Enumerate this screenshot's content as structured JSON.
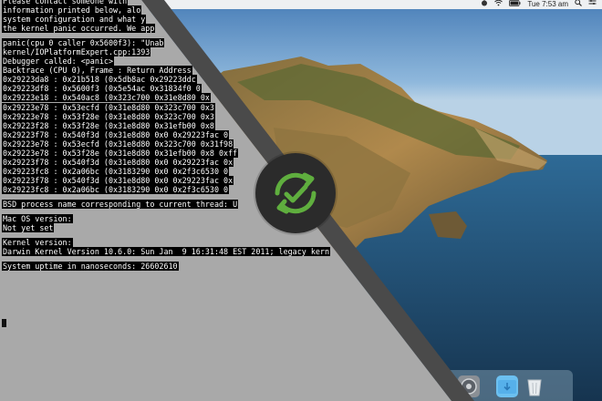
{
  "menubar": {
    "time": "Tue 7:53 am",
    "icons": [
      "apple-icon",
      "wifi-icon",
      "battery-icon",
      "clock-time",
      "search-icon",
      "control-center-icon"
    ]
  },
  "panic": {
    "lines": [
      "Please contact someone with",
      "information printed below, alo",
      "system configuration and what y",
      "the kernel panic occurred. We app",
      "",
      "panic(cpu 0 caller 0x5600f3): \"Unab",
      "kernel/IOPlatformExpert.cpp:1393",
      "Debugger called: <panic>",
      "Backtrace (CPU 0), Frame : Return Address",
      "0x29223da8 : 0x21b518 (0x5db8ac 0x29223ddc",
      "0x29223df8 : 0x5600f3 (0x5e54ac 0x31834f0 0",
      "0x29223e18 : 0x540ac8 (0x323c700 0x31e8d80 0x",
      "0x29223e78 : 0x53ecfd (0x31e8d80 0x323c700 0x3",
      "0x29223e78 : 0x53f28e (0x31e8d80 0x323c700 0x3",
      "0x29223f28 : 0x53f28e (0x31e8d80 0x31efb00 0x8",
      "0x29223f78 : 0x540f3d (0x31e8d80 0x0 0x29223fac 0",
      "0x29223e78 : 0x53ecfd (0x31e8d80 0x323c700 0x31f98",
      "0x29223e78 : 0x53f28e (0x31e8d80 0x31efb00 0x8 0xff",
      "0x29223f78 : 0x540f3d (0x31e8d80 0x0 0x29223fac 0x",
      "0x29223fc8 : 0x2a06bc (0x3183290 0x0 0x2f3c6530 0",
      "0x29223f78 : 0x540f3d (0x31e8d80 0x0 0x29223fac 0x",
      "0x29223fc8 : 0x2a06bc (0x3183290 0x0 0x2f3c6530 0",
      "",
      "BSD process name corresponding to current thread: U",
      "",
      "Mac OS version:",
      "Not yet set",
      "",
      "Kernel version:",
      "Darwin Kernel Version 10.6.0: Sun Jan  9 16:31:48 EST 2011; legacy kern",
      "",
      "System uptime in nanoseconds: 26602610"
    ]
  },
  "colors": {
    "panic_gray": "#a9a9a9",
    "sync_bg": "#2b2b2b",
    "sync_green": "#5fae3e"
  },
  "dock": {
    "items": [
      "system-preferences-icon",
      "downloads-folder-icon",
      "trash-icon"
    ]
  }
}
